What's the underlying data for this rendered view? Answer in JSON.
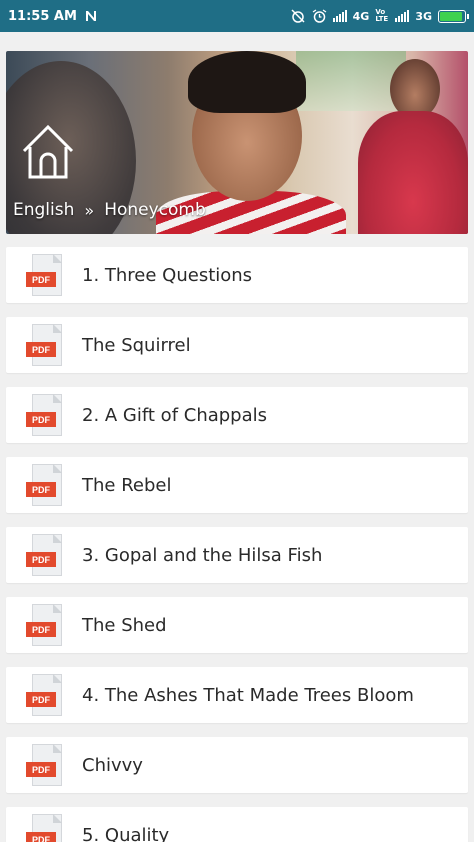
{
  "status_bar": {
    "time": "11:55 AM",
    "notification_icon": "N-logo-icon",
    "net1": "4G",
    "volte": "Vo LTE",
    "net2": "3G",
    "battery_level": 0.85,
    "battery_color": "#3fd14f"
  },
  "header": {
    "breadcrumb": [
      "English",
      "Honeycomb"
    ],
    "separator": "»",
    "home_icon": "home-icon"
  },
  "items": [
    {
      "label": "1. Three Questions",
      "icon": "pdf-icon"
    },
    {
      "label": "The Squirrel",
      "icon": "pdf-icon"
    },
    {
      "label": "2. A Gift of Chappals",
      "icon": "pdf-icon"
    },
    {
      "label": "The Rebel",
      "icon": "pdf-icon"
    },
    {
      "label": "3. Gopal and the Hilsa Fish",
      "icon": "pdf-icon"
    },
    {
      "label": "The Shed",
      "icon": "pdf-icon"
    },
    {
      "label": "4. The Ashes That Made Trees Bloom",
      "icon": "pdf-icon"
    },
    {
      "label": "Chivvy",
      "icon": "pdf-icon"
    },
    {
      "label": "5. Quality",
      "icon": "pdf-icon"
    }
  ],
  "pdf_tag": "PDF",
  "colors": {
    "status_bar": "#1f6e86",
    "pdf_tag": "#e24a2d",
    "background": "#f0f0f0"
  }
}
